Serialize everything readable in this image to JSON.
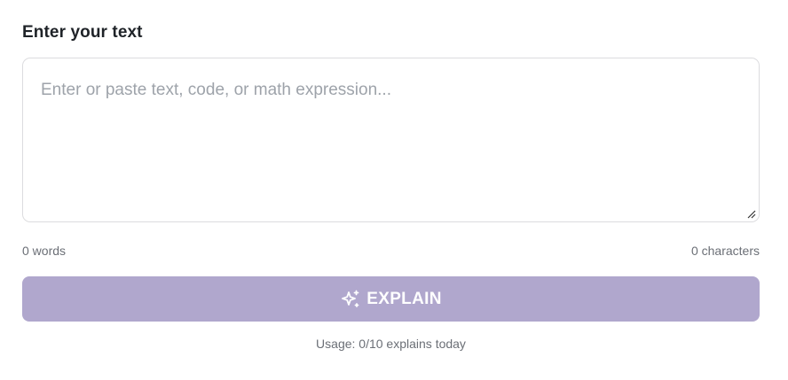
{
  "input": {
    "label": "Enter your text",
    "placeholder": "Enter or paste text, code, or math expression...",
    "value": ""
  },
  "stats": {
    "words": "0 words",
    "characters": "0 characters"
  },
  "explain_button": {
    "label": "EXPLAIN",
    "icon": "sparkles-icon",
    "color": "#b0a7cd",
    "disabled": true
  },
  "usage": {
    "text": "Usage: 0/10 explains today"
  }
}
